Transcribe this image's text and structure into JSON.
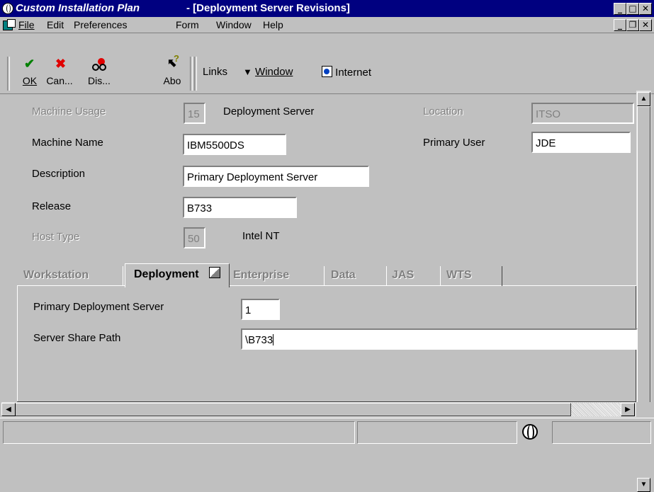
{
  "window": {
    "app_title": "Custom Installation Plan",
    "doc_title": "- [Deployment Server Revisions]",
    "title_bg": "#000080"
  },
  "menu": [
    "File",
    "Edit",
    "Preferences",
    "Form",
    "Window",
    "Help"
  ],
  "toolbar": {
    "ok": "OK",
    "cancel": "Can...",
    "display": "Dis...",
    "about": "Abo",
    "links": "Links",
    "window": "Window",
    "internet": "Internet"
  },
  "form": {
    "machine_usage_label": "Machine Usage",
    "machine_usage_value": "15",
    "machine_usage_desc": "Deployment Server",
    "location_label": "Location",
    "location_value": "ITSO",
    "machine_name_label": "Machine Name",
    "machine_name_value": "IBM5500DS",
    "primary_user_label": "Primary User",
    "primary_user_value": "JDE",
    "description_label": "Description",
    "description_value": "Primary Deployment Server",
    "release_label": "Release",
    "release_value": "B733",
    "host_type_label": "Host Type",
    "host_type_value": "50",
    "host_type_desc": "Intel NT"
  },
  "tabs": [
    "Workstation",
    "Deployment",
    "Enterprise",
    "Data",
    "JAS",
    "WTS"
  ],
  "active_tab": "Deployment",
  "deployment_tab": {
    "primary_server_label": "Primary Deployment Server",
    "primary_server_value": "1",
    "share_path_label": "Server Share Path",
    "share_path_value": "\\B733"
  }
}
